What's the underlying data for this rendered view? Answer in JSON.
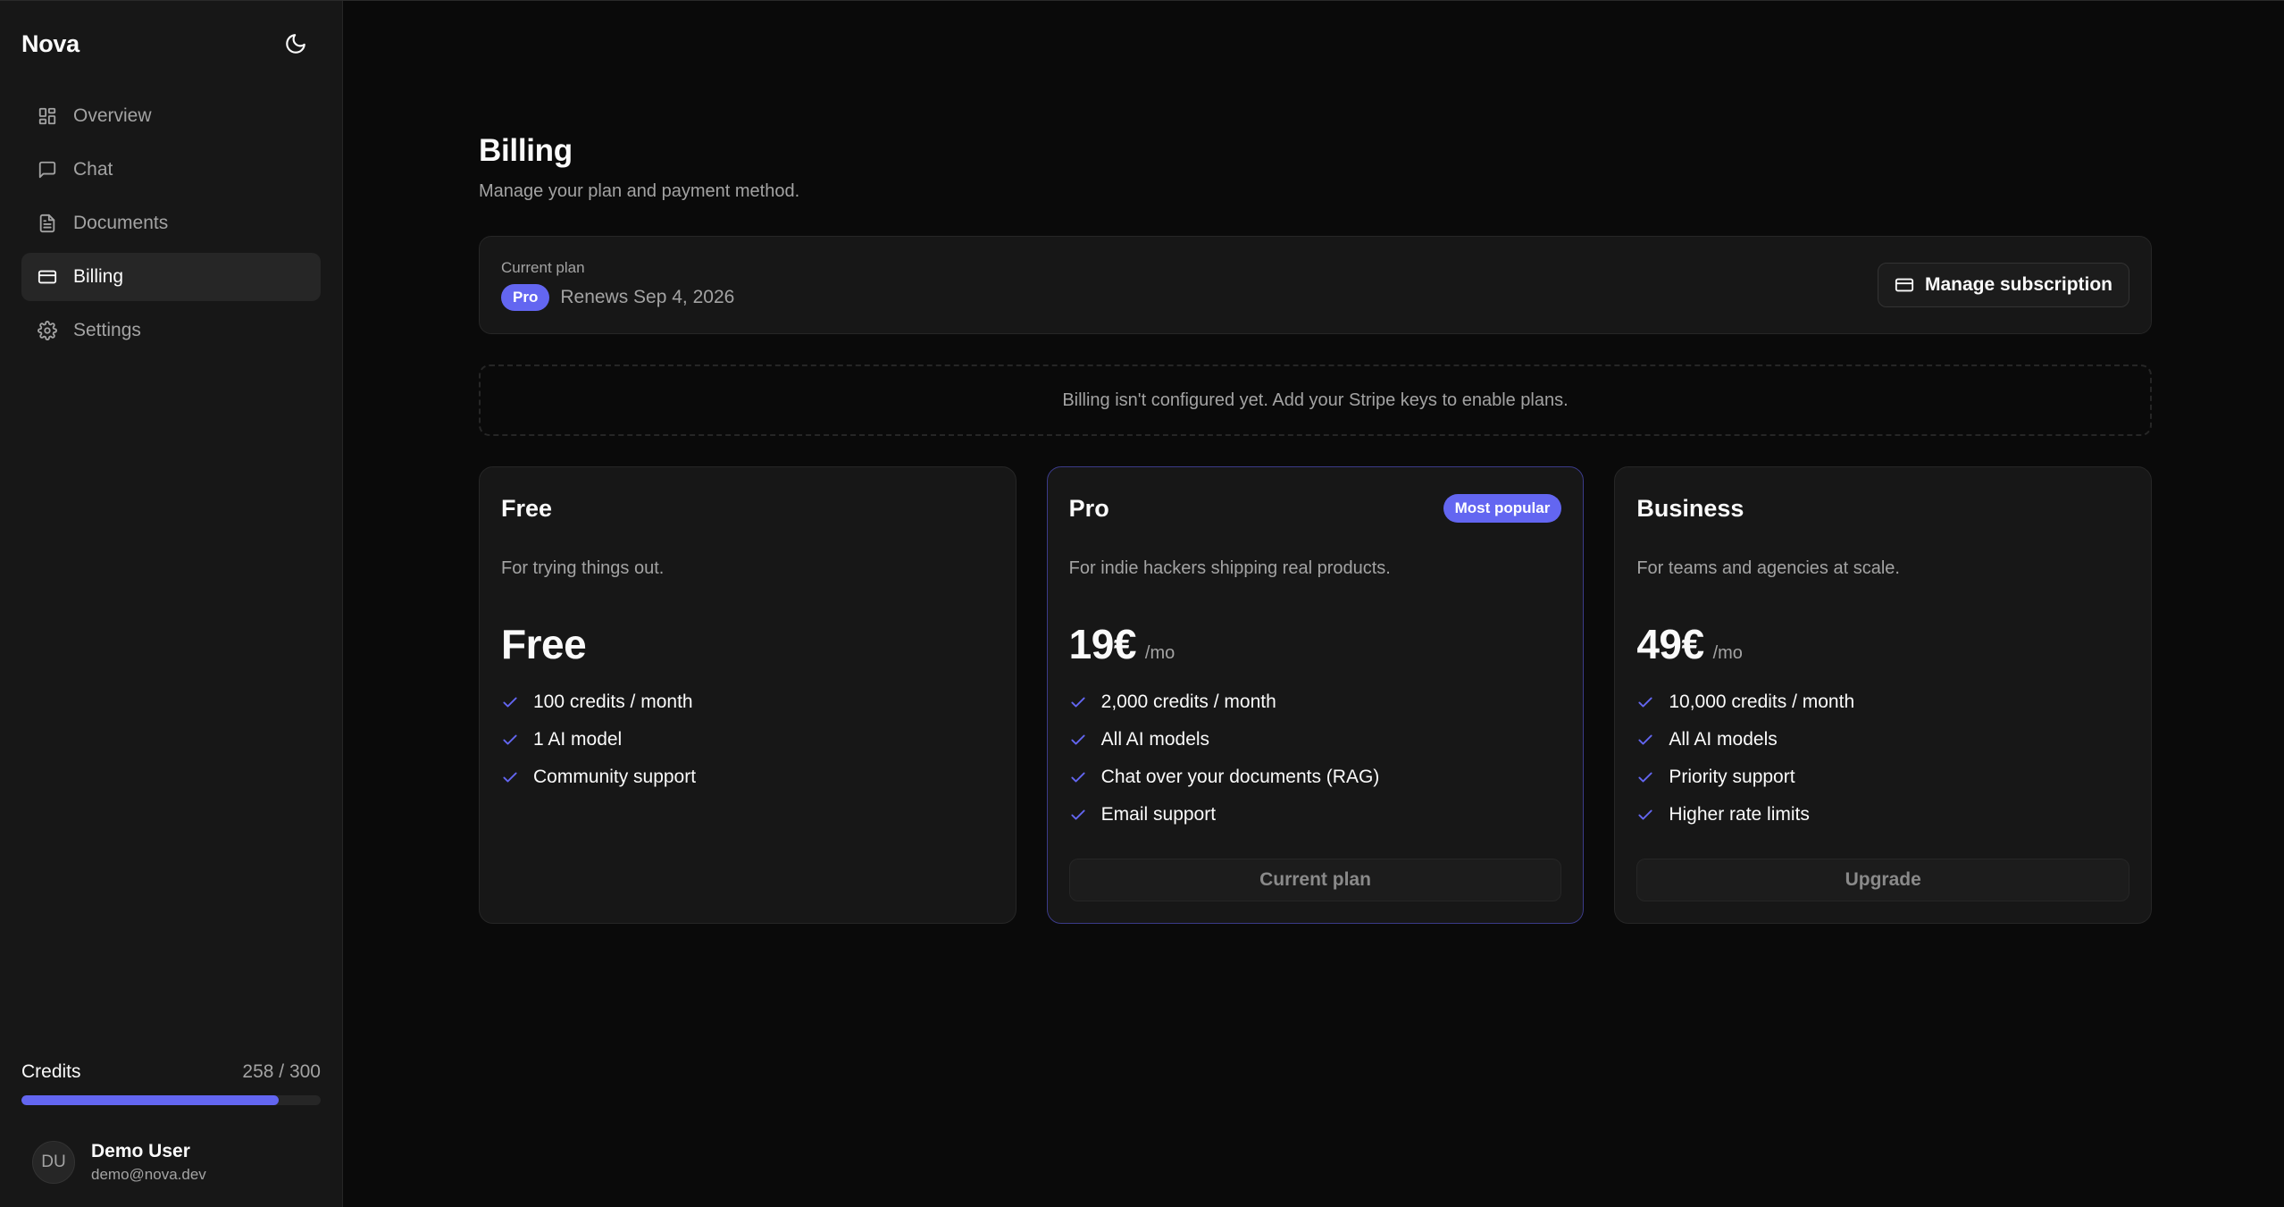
{
  "app": {
    "brand": "Nova"
  },
  "sidebar": {
    "items": [
      {
        "label": "Overview",
        "icon": "dashboard-icon"
      },
      {
        "label": "Chat",
        "icon": "chat-icon"
      },
      {
        "label": "Documents",
        "icon": "document-icon"
      },
      {
        "label": "Billing",
        "icon": "credit-card-icon",
        "active": true
      },
      {
        "label": "Settings",
        "icon": "gear-icon"
      }
    ],
    "credits": {
      "label": "Credits",
      "value": "258 / 300",
      "used": 258,
      "total": 300
    },
    "user": {
      "initials": "DU",
      "name": "Demo User",
      "email": "demo@nova.dev"
    }
  },
  "page": {
    "title": "Billing",
    "subtitle": "Manage your plan and payment method."
  },
  "current_plan": {
    "label": "Current plan",
    "badge": "Pro",
    "renews": "Renews Sep 4, 2026",
    "manage_label": "Manage subscription"
  },
  "notice": "Billing isn't configured yet. Add your Stripe keys to enable plans.",
  "plans": [
    {
      "name": "Free",
      "description": "For trying things out.",
      "price": "Free",
      "per": "",
      "features": [
        "100 credits / month",
        "1 AI model",
        "Community support"
      ]
    },
    {
      "name": "Pro",
      "badge": "Most popular",
      "description": "For indie hackers shipping real products.",
      "price": "19€",
      "per": "/mo",
      "features": [
        "2,000 credits / month",
        "All AI models",
        "Chat over your documents (RAG)",
        "Email support"
      ],
      "button": "Current plan"
    },
    {
      "name": "Business",
      "description": "For teams and agencies at scale.",
      "price": "49€",
      "per": "/mo",
      "features": [
        "10,000 credits / month",
        "All AI models",
        "Priority support",
        "Higher rate limits"
      ],
      "button": "Upgrade"
    }
  ],
  "colors": {
    "accent": "#6366f1",
    "background": "#0a0a0a",
    "surface": "#171717",
    "border": "#262626",
    "muted": "#a3a3a3"
  }
}
